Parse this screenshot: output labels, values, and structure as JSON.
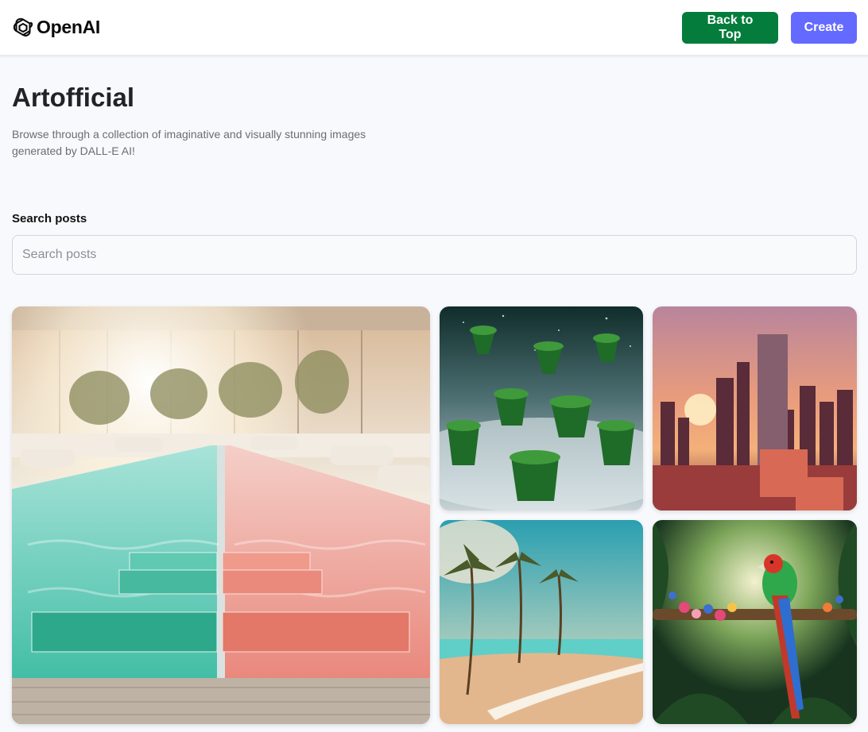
{
  "header": {
    "logo_text": "OpenAI",
    "logo_icon": "openai-logo-icon",
    "back_to_top_label": "Back to Top",
    "create_label": "Create"
  },
  "hero": {
    "title": "Artofficial",
    "subtitle": "Browse through a collection of imaginative and visually stunning images generated by DALL-E AI!"
  },
  "search": {
    "label": "Search posts",
    "placeholder": "Search posts",
    "value": ""
  },
  "gallery": {
    "images": [
      "indoor-pool-image",
      "floating-islands-image",
      "sunset-city-image",
      "tropical-beach-image",
      "jungle-parrot-image"
    ]
  },
  "colors": {
    "back_to_top": "#047c3c",
    "create": "#6469ff",
    "background": "#f8f9fc"
  }
}
